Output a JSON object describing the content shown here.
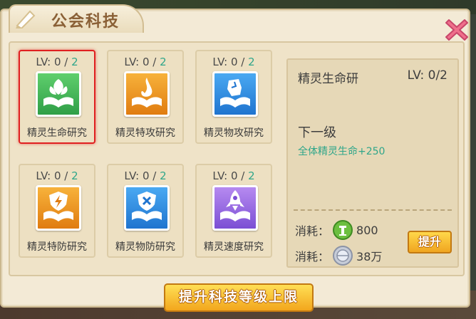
{
  "window": {
    "title": "公会科技"
  },
  "techs": [
    {
      "lv_prefix": "LV: 0 / ",
      "lv_max": "2",
      "name": "精灵生命研究",
      "icon": "leaf-book-icon",
      "color_top": "#5fcf6d",
      "color_bottom": "#2f9e47"
    },
    {
      "lv_prefix": "LV: 0 / ",
      "lv_max": "2",
      "name": "精灵特攻研究",
      "icon": "flame-book-icon",
      "color_top": "#f7b23b",
      "color_bottom": "#e07c10"
    },
    {
      "lv_prefix": "LV: 0 / ",
      "lv_max": "2",
      "name": "精灵物攻研究",
      "icon": "fist-book-icon",
      "color_top": "#4aa9f2",
      "color_bottom": "#1f74cf"
    },
    {
      "lv_prefix": "LV: 0 / ",
      "lv_max": "2",
      "name": "精灵特防研究",
      "icon": "shield-bolt-book-icon",
      "color_top": "#f7b23b",
      "color_bottom": "#e07c10"
    },
    {
      "lv_prefix": "LV: 0 / ",
      "lv_max": "2",
      "name": "精灵物防研究",
      "icon": "shield-cross-book-icon",
      "color_top": "#4aa9f2",
      "color_bottom": "#1f74cf"
    },
    {
      "lv_prefix": "LV: 0 / ",
      "lv_max": "2",
      "name": "精灵速度研究",
      "icon": "rocket-book-icon",
      "color_top": "#b68af0",
      "color_bottom": "#7c4fd4"
    }
  ],
  "detail": {
    "name": "精灵生命研",
    "lv": "LV: 0/2",
    "next_label": "下一级",
    "next_effect": "全体精灵生命+250",
    "cost_label_1": "消耗：",
    "cost_amount_1": "800",
    "cost_label_2": "消耗：",
    "cost_amount_2": "38万",
    "upgrade_label": "提升"
  },
  "raise_limit_label": "提升科技等级上限",
  "colors": {
    "accent_green": "#2fa68a",
    "button_gold": "#f2a61d",
    "close_pink": "#e8587a",
    "selected_border": "#e02020"
  }
}
